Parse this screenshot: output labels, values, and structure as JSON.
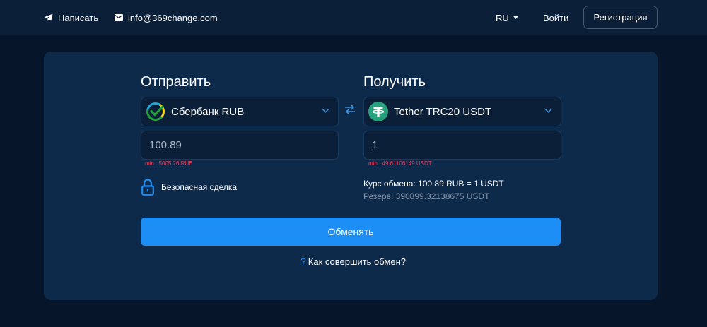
{
  "header": {
    "write_label": "Написать",
    "email": "info@369change.com",
    "lang": "RU",
    "login_label": "Войти",
    "register_label": "Регистрация"
  },
  "send": {
    "title": "Отправить",
    "currency": "Сбербанк RUB",
    "amount": "100.89",
    "min_label": "min.: 5005.26 RUB"
  },
  "receive": {
    "title": "Получить",
    "currency": "Tether TRC20 USDT",
    "amount": "1",
    "min_label": "min.: 49.61106149 USDT"
  },
  "secure_label": "Безопасная сделка",
  "rate_label": "Курс обмена: 100.89 RUB = 1 USDT",
  "reserve_label": "Резерв: 390899.32138675 USDT",
  "exchange_button": "Обменять",
  "howto": {
    "icon": "?",
    "label": "Как совершить обмен?"
  },
  "colors": {
    "background": "#06152a",
    "header": "#0b1f38",
    "card": "#0e2a4b",
    "accent": "#1c8ef5",
    "error": "#e63a5a",
    "tether": "#26a17b",
    "sber": "#21a038"
  }
}
